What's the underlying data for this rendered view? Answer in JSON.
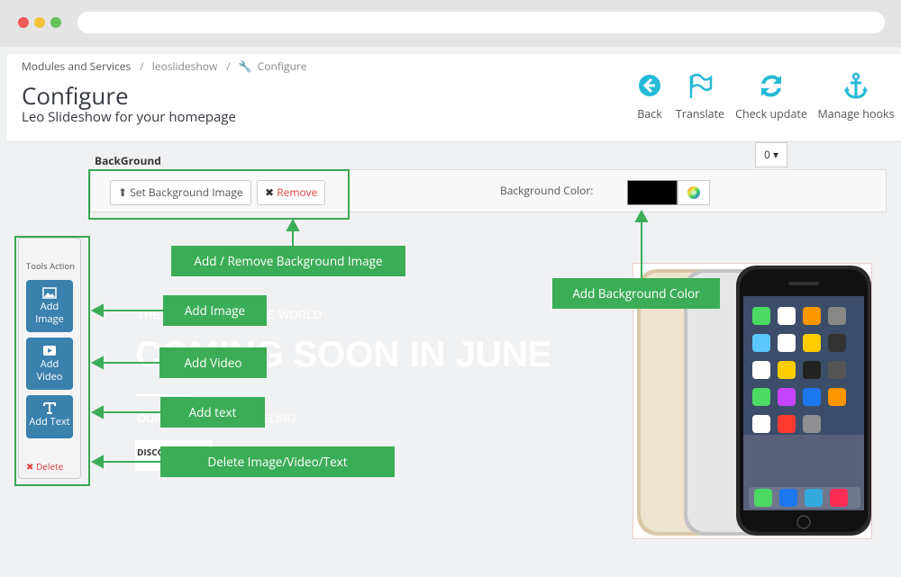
{
  "breadcrumb": {
    "items": [
      "Modules and Services",
      "leoslideshow",
      "Configure"
    ]
  },
  "header": {
    "title": "Configure",
    "subtitle": "Leo Slideshow for your homepage"
  },
  "toolbar": {
    "back": "Back",
    "translate": "Translate",
    "check_update": "Check update",
    "manage_hooks": "Manage hooks"
  },
  "language_select": {
    "value": "0"
  },
  "background": {
    "section_label": "BackGround",
    "set_image_button": "Set Background Image",
    "remove_button": "Remove",
    "color_label": "Background Color:",
    "color_value": "#000000"
  },
  "tools": {
    "title": "Tools Action",
    "add_image": "Add Image",
    "add_video": "Add Video",
    "add_text": "Add Text",
    "delete": "Delete"
  },
  "callouts": {
    "bg_image": "Add / Remove Background Image",
    "bg_color": "Add Background Color",
    "add_image": "Add Image",
    "add_video": "Add Video",
    "add_text": "Add text",
    "delete": "Delete Image/Video/Text"
  },
  "slide": {
    "line1": "THE BEST THING IN THE WORLD",
    "headline": "COMING SOON IN JUNE",
    "line3": "OUR CUSTOMER'S FEELING",
    "button": "DISCOVER"
  },
  "colors": {
    "accent_green": "#3cad57",
    "tool_blue": "#3a81ad",
    "toolbar_icon": "#25b9d7",
    "danger": "#e03f3f"
  }
}
